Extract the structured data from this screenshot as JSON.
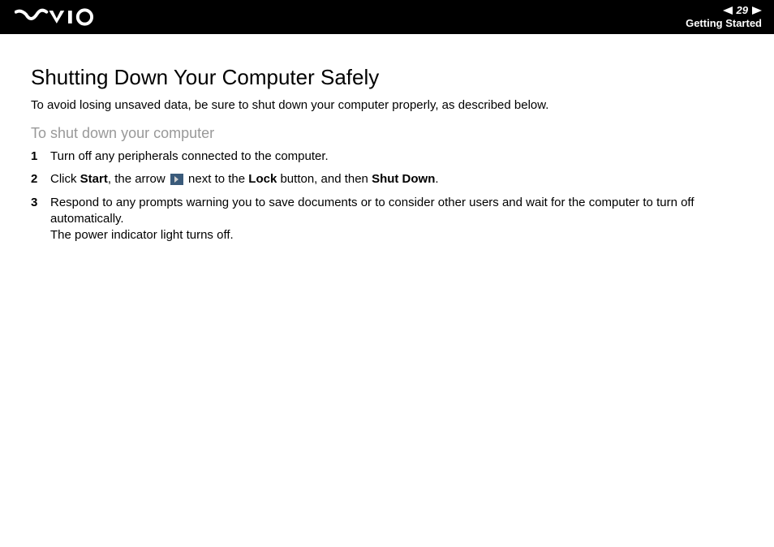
{
  "header": {
    "page_number": "29",
    "section": "Getting Started"
  },
  "content": {
    "title": "Shutting Down Your Computer Safely",
    "intro": "To avoid losing unsaved data, be sure to shut down your computer properly, as described below.",
    "sub_title": "To shut down your computer",
    "steps": [
      {
        "num": "1",
        "text_plain": "Turn off any peripherals connected to the computer."
      },
      {
        "num": "2",
        "parts": {
          "p1": "Click ",
          "b1": "Start",
          "p2": ", the arrow ",
          "p3": " next to the ",
          "b2": "Lock",
          "p4": " button, and then ",
          "b3": "Shut Down",
          "p5": "."
        }
      },
      {
        "num": "3",
        "line1": "Respond to any prompts warning you to save documents or to consider other users and wait for the computer to turn off automatically.",
        "line2": "The power indicator light turns off."
      }
    ]
  }
}
